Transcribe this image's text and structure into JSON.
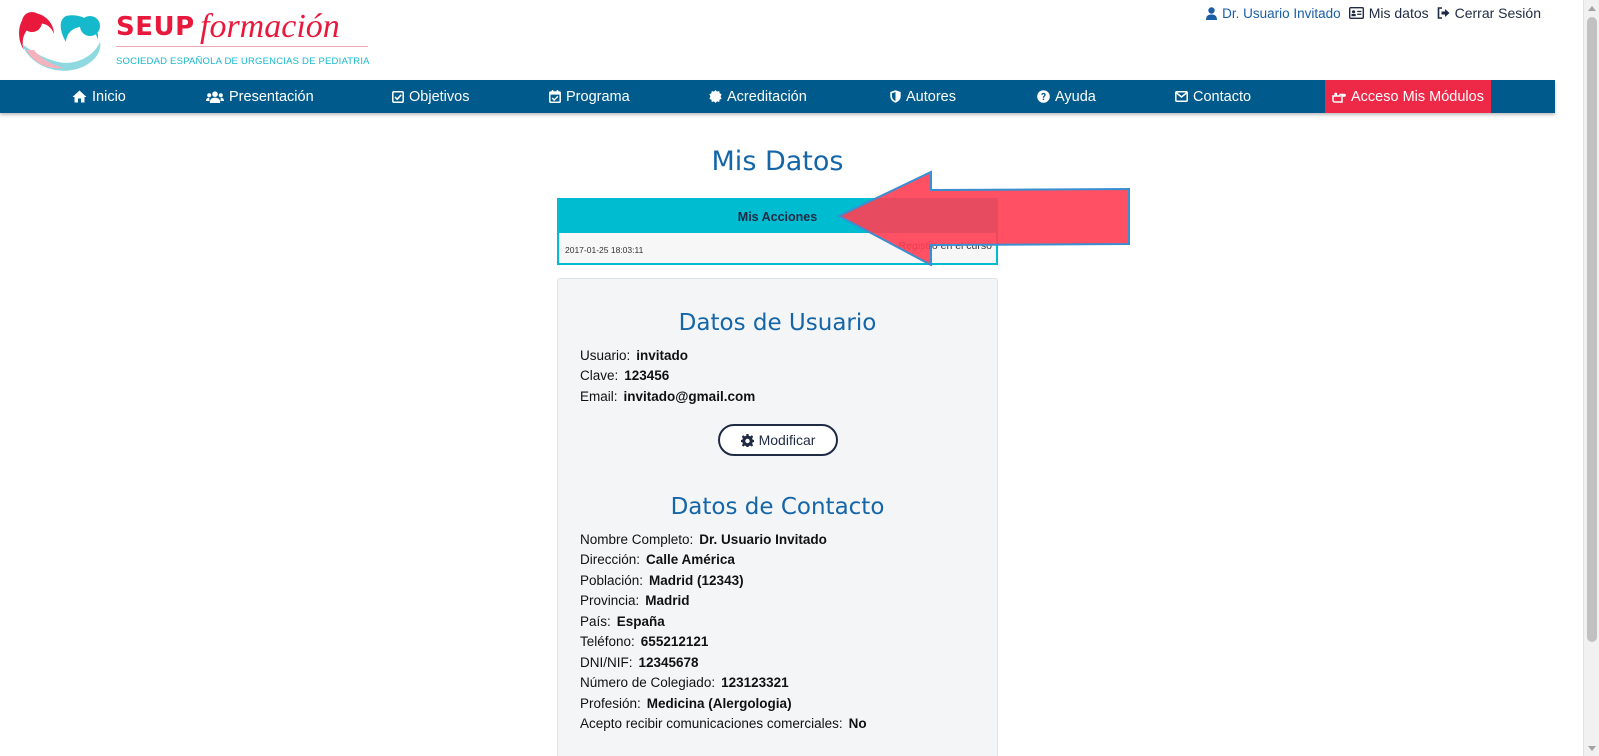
{
  "logo": {
    "brand": "SEUP",
    "script": "formación",
    "subtitle": "SOCIEDAD ESPAÑOLA DE URGENCIAS DE PEDIATRIA"
  },
  "top_links": {
    "user": "Dr. Usuario Invitado",
    "mis_datos": "Mis datos",
    "logout": "Cerrar Sesión"
  },
  "nav": {
    "items": [
      {
        "label": "Inicio",
        "icon": "home-icon"
      },
      {
        "label": "Presentación",
        "icon": "users-icon"
      },
      {
        "label": "Objetivos",
        "icon": "check-square-icon"
      },
      {
        "label": "Programa",
        "icon": "calendar-check-icon"
      },
      {
        "label": "Acreditación",
        "icon": "certificate-icon"
      },
      {
        "label": "Autores",
        "icon": "shield-icon"
      },
      {
        "label": "Ayuda",
        "icon": "question-circle-icon"
      },
      {
        "label": "Contacto",
        "icon": "envelope-icon"
      }
    ],
    "cta": {
      "label": "Acceso Mis Módulos",
      "icon": "hand-pointer-icon"
    }
  },
  "page": {
    "title": "Mis Datos"
  },
  "acciones": {
    "header": "Mis Acciones",
    "rows": [
      {
        "date": "2017-01-25 18:03:11",
        "desc": "Registro en el curso"
      }
    ]
  },
  "usuario": {
    "title": "Datos de Usuario",
    "fields": [
      {
        "label": "Usuario:",
        "value": "invitado"
      },
      {
        "label": "Clave:",
        "value": "123456"
      },
      {
        "label": "Email:",
        "value": "invitado@gmail.com"
      }
    ],
    "button": "Modificar"
  },
  "contacto": {
    "title": "Datos de Contacto",
    "fields": [
      {
        "label": "Nombre Completo:",
        "value": "Dr. Usuario Invitado"
      },
      {
        "label": "Dirección:",
        "value": "Calle América"
      },
      {
        "label": "Población:",
        "value": "Madrid (12343)"
      },
      {
        "label": "Provincia:",
        "value": "Madrid"
      },
      {
        "label": "País:",
        "value": "España"
      },
      {
        "label": "Teléfono:",
        "value": "655212121"
      },
      {
        "label": "DNI/NIF:",
        "value": "12345678"
      },
      {
        "label": "Número de Colegiado:",
        "value": "123123321"
      },
      {
        "label": "Profesión:",
        "value": "Medicina (Alergologia)"
      },
      {
        "label": "Acepto recibir comunicaciones comerciales:",
        "value": "No"
      }
    ]
  },
  "colors": {
    "nav_bg": "#005a8b",
    "cta_bg": "#ee2847",
    "accent_cyan": "#00bcd0",
    "title_blue": "#1466a8",
    "brand_red": "#e8193c",
    "annotation_arrow": "#ff4d5e"
  }
}
